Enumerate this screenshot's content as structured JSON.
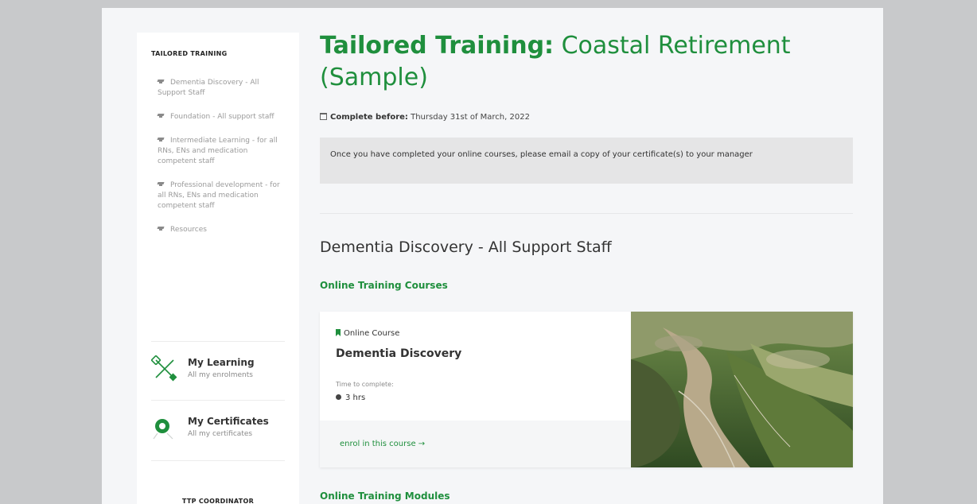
{
  "sidebar": {
    "heading": "TAILORED TRAINING",
    "items": [
      {
        "label": "Dementia Discovery - All Support Staff"
      },
      {
        "label": "Foundation - All support staff"
      },
      {
        "label": "Intermediate Learning - for all RNs, ENs and medication competent staff"
      },
      {
        "label": "Professional development - for all RNs, ENs and medication competent staff"
      },
      {
        "label": "Resources"
      }
    ],
    "my_learning": {
      "title": "My Learning",
      "subtitle": "All my enrolments"
    },
    "my_certificates": {
      "title": "My Certificates",
      "subtitle": "All my certificates"
    },
    "coordinator_heading": "TTP COORDINATOR"
  },
  "main": {
    "title_bold": "Tailored Training:",
    "title_rest": " Coastal Retirement (Sample)",
    "complete_label": "Complete before:",
    "complete_date": "Thursday 31st of March, 2022",
    "notice": "Once you have completed your online courses, please email a copy of your certificate(s) to your manager",
    "section_title": "Dementia Discovery - All Support Staff",
    "courses_heading": "Online Training Courses",
    "card": {
      "type": "Online Course",
      "title": "Dementia Discovery",
      "time_label": "Time to complete:",
      "time_value": "3 hrs",
      "enrol_label": "enrol in this course →"
    },
    "modules_heading": "Online Training Modules"
  },
  "colors": {
    "brand_green": "#1f8f3d",
    "page_bg": "#f5f6f8",
    "outer_bg": "#c8c9cb",
    "notice_bg": "#e5e5e6"
  }
}
